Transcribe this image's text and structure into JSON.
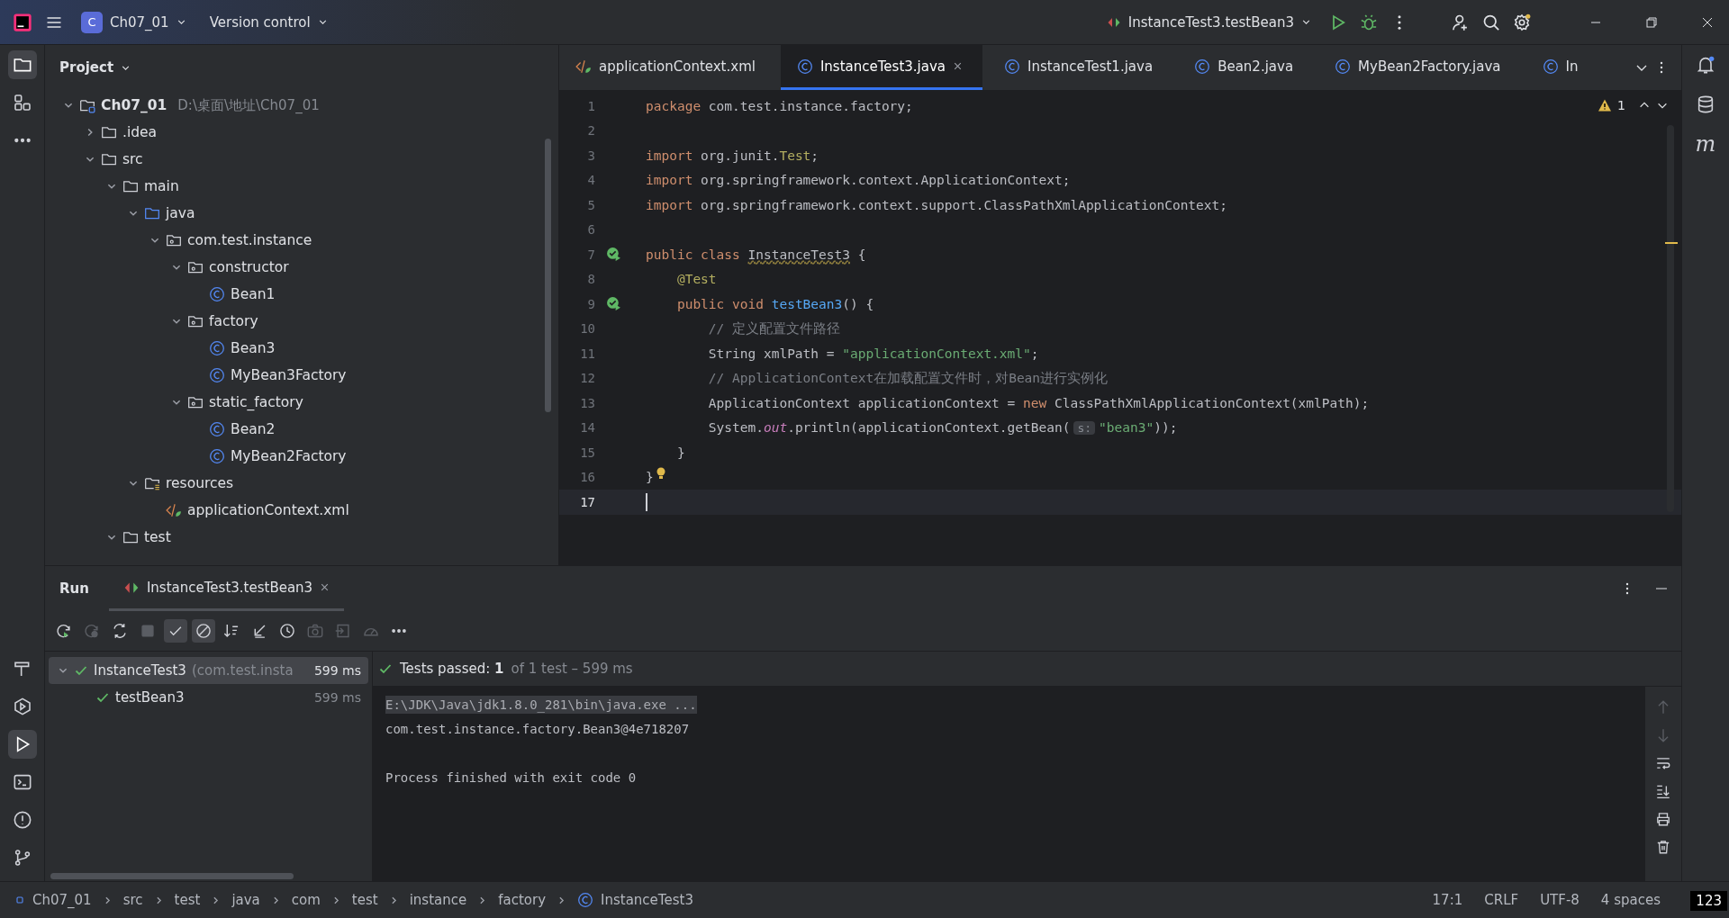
{
  "title_bar": {
    "project_badge": "C",
    "project": "Ch07_01",
    "vcs": "Version control",
    "run_config": "InstanceTest3.testBean3"
  },
  "left_stripe": {
    "top": [
      {
        "kind": "folder",
        "selected": true
      },
      {
        "kind": "structure",
        "selected": false
      },
      {
        "kind": "more",
        "selected": false
      }
    ],
    "bottom": [
      {
        "kind": "build",
        "selected": false
      },
      {
        "kind": "services",
        "selected": false
      },
      {
        "kind": "run",
        "selected": true
      },
      {
        "kind": "terminal",
        "selected": false
      },
      {
        "kind": "problems",
        "selected": false
      },
      {
        "kind": "git",
        "selected": false
      }
    ]
  },
  "project_panel": {
    "title": "Project",
    "tree": [
      {
        "kind": "module",
        "name": "Ch07_01",
        "path": "D:\\桌面\\地址\\Ch07_01",
        "expanded": true,
        "children": [
          {
            "kind": "folder",
            "name": ".idea",
            "expanded": false
          },
          {
            "kind": "folder",
            "name": "src",
            "expanded": true,
            "children": [
              {
                "kind": "folder",
                "name": "main",
                "expanded": true,
                "children": [
                  {
                    "kind": "source",
                    "name": "java",
                    "expanded": true,
                    "children": [
                      {
                        "kind": "package",
                        "name": "com.test.instance",
                        "expanded": true,
                        "children": [
                          {
                            "kind": "package",
                            "name": "constructor",
                            "expanded": true,
                            "children": [
                              {
                                "kind": "class",
                                "name": "Bean1"
                              }
                            ]
                          },
                          {
                            "kind": "package",
                            "name": "factory",
                            "expanded": true,
                            "children": [
                              {
                                "kind": "class",
                                "name": "Bean3"
                              },
                              {
                                "kind": "class",
                                "name": "MyBean3Factory"
                              }
                            ]
                          },
                          {
                            "kind": "package",
                            "name": "static_factory",
                            "expanded": true,
                            "children": [
                              {
                                "kind": "class",
                                "name": "Bean2"
                              },
                              {
                                "kind": "class",
                                "name": "MyBean2Factory"
                              }
                            ]
                          }
                        ]
                      }
                    ]
                  },
                  {
                    "kind": "resources",
                    "name": "resources",
                    "expanded": true,
                    "children": [
                      {
                        "kind": "xml",
                        "name": "applicationContext.xml"
                      }
                    ]
                  }
                ]
              },
              {
                "kind": "folder",
                "name": "test",
                "expanded": true
              }
            ]
          }
        ]
      }
    ]
  },
  "editor": {
    "tabs": [
      {
        "kind": "xml",
        "label": "applicationContext.xml",
        "selected": false
      },
      {
        "kind": "class",
        "label": "InstanceTest3.java",
        "selected": true
      },
      {
        "kind": "class",
        "label": "InstanceTest1.java",
        "selected": false
      },
      {
        "kind": "class",
        "label": "Bean2.java",
        "selected": false
      },
      {
        "kind": "class",
        "label": "MyBean2Factory.java",
        "selected": false
      },
      {
        "kind": "class",
        "label": "In",
        "selected": false
      }
    ],
    "warning_count": "1",
    "lines": [
      {
        "number": "1",
        "tokens": [
          {
            "kind": "kw",
            "text": "package"
          },
          {
            "kind": "plain",
            "text": " com.test.instance.factory;"
          }
        ]
      },
      {
        "number": "2"
      },
      {
        "number": "3",
        "tokens": [
          {
            "kind": "kw",
            "text": "import"
          },
          {
            "kind": "plain",
            "text": " org.junit."
          },
          {
            "kind": "ann",
            "text": "Test"
          },
          {
            "kind": "plain",
            "text": ";"
          }
        ]
      },
      {
        "number": "4",
        "tokens": [
          {
            "kind": "kw",
            "text": "import"
          },
          {
            "kind": "plain",
            "text": " org.springframework.context.ApplicationContext;"
          }
        ]
      },
      {
        "number": "5",
        "tokens": [
          {
            "kind": "kw",
            "text": "import"
          },
          {
            "kind": "plain",
            "text": " org.springframework.context.support.ClassPathXmlApplicationContext;"
          }
        ]
      },
      {
        "number": "6"
      },
      {
        "number": "7",
        "run_marker": true,
        "tokens": [
          {
            "kind": "kw",
            "text": "public class "
          },
          {
            "kind": "decl",
            "text": "InstanceTest3"
          },
          {
            "kind": "plain",
            "text": " {"
          }
        ]
      },
      {
        "number": "8",
        "tokens": [
          {
            "kind": "ann",
            "text": "    @Test"
          }
        ]
      },
      {
        "number": "9",
        "run_marker": true,
        "tokens": [
          {
            "kind": "kw",
            "text": "    public void "
          },
          {
            "kind": "fn",
            "text": "testBean3"
          },
          {
            "kind": "plain",
            "text": "() {"
          }
        ]
      },
      {
        "number": "10",
        "tokens": [
          {
            "kind": "comment",
            "text": "        // 定义配置文件路径"
          }
        ]
      },
      {
        "number": "11",
        "tokens": [
          {
            "kind": "plain",
            "text": "        String xmlPath = "
          },
          {
            "kind": "str",
            "text": "\"applicationContext.xml\""
          },
          {
            "kind": "plain",
            "text": ";"
          }
        ]
      },
      {
        "number": "12",
        "tokens": [
          {
            "kind": "comment",
            "text": "        // ApplicationContext在加载配置文件时，对Bean进行实例化"
          }
        ]
      },
      {
        "number": "13",
        "tokens": [
          {
            "kind": "plain",
            "text": "        ApplicationContext applicationContext = "
          },
          {
            "kind": "kw",
            "text": "new"
          },
          {
            "kind": "plain",
            "text": " ClassPathXmlApplicationContext(xmlPath);"
          }
        ]
      },
      {
        "number": "14",
        "tokens": [
          {
            "kind": "plain",
            "text": "        System."
          },
          {
            "kind": "static",
            "text": "out"
          },
          {
            "kind": "plain",
            "text": ".println(applicationContext.getBean("
          },
          {
            "kind": "hint",
            "text": "s:"
          },
          {
            "kind": "str",
            "text": "\"bean3\""
          },
          {
            "kind": "plain",
            "text": "));"
          }
        ]
      },
      {
        "number": "15",
        "tokens": [
          {
            "kind": "plain",
            "text": "    }"
          }
        ]
      },
      {
        "number": "16",
        "bulb": true,
        "tokens": [
          {
            "kind": "plain",
            "text": "}"
          }
        ]
      },
      {
        "number": "17",
        "current": true
      }
    ]
  },
  "right_stripe": [
    {
      "kind": "bell"
    },
    {
      "kind": "database"
    },
    {
      "kind": "maven",
      "label": "m"
    }
  ],
  "run_panel": {
    "title": "Run",
    "tab": "InstanceTest3.testBean3",
    "toolbar": [
      {
        "kind": "rerun",
        "on": false,
        "disabled": false
      },
      {
        "kind": "rerun-failed",
        "on": false,
        "disabled": true
      },
      {
        "kind": "toggle",
        "on": false,
        "disabled": false
      },
      {
        "kind": "stop",
        "on": false,
        "disabled": true
      },
      {
        "kind": "check",
        "on": true,
        "disabled": false
      },
      {
        "kind": "ignored",
        "on": true,
        "disabled": false
      },
      {
        "kind": "sort",
        "on": false,
        "disabled": false
      },
      {
        "kind": "collapse",
        "on": false,
        "disabled": false
      },
      {
        "kind": "history",
        "on": false,
        "disabled": false
      },
      {
        "kind": "camera",
        "on": false,
        "disabled": true
      },
      {
        "kind": "export",
        "on": false,
        "disabled": true
      },
      {
        "kind": "gauge",
        "on": false,
        "disabled": true
      },
      {
        "kind": "more",
        "on": false,
        "disabled": false
      }
    ],
    "tests": [
      {
        "name": "InstanceTest3",
        "detail": "(com.test.insta",
        "time": "599 ms",
        "selected": true,
        "expanded": true,
        "children": [
          {
            "name": "testBean3",
            "time": "599 ms",
            "selected": false
          }
        ]
      }
    ],
    "summary": "Tests passed: **1**",
    "summary_detail": "of 1 test – 599 ms",
    "console": [
      {
        "kind": "command",
        "text": "E:\\JDK\\Java\\jdk1.8.0_281\\bin\\java.exe ..."
      },
      {
        "kind": "output",
        "text": "com.test.instance.factory.Bean3@4e718207"
      },
      {
        "kind": "exit",
        "text": "Process finished with exit code 0"
      }
    ],
    "side_tools": [
      {
        "kind": "up",
        "disabled": true
      },
      {
        "kind": "down",
        "disabled": true
      },
      {
        "kind": "wrap",
        "disabled": false
      },
      {
        "kind": "scroll-end",
        "disabled": false
      },
      {
        "kind": "print",
        "disabled": false
      },
      {
        "kind": "trash",
        "disabled": false
      }
    ]
  },
  "status_bar": {
    "breadcrumbs": [
      {
        "kind": "module",
        "text": "Ch07_01"
      },
      {
        "kind": "dir",
        "text": "src"
      },
      {
        "kind": "dir",
        "text": "test"
      },
      {
        "kind": "dir",
        "text": "java"
      },
      {
        "kind": "dir",
        "text": "com"
      },
      {
        "kind": "dir",
        "text": "test"
      },
      {
        "kind": "dir",
        "text": "instance"
      },
      {
        "kind": "dir",
        "text": "factory"
      },
      {
        "kind": "class",
        "text": "InstanceTest3"
      }
    ],
    "position": "17:1",
    "line_separator": "CRLF",
    "encoding": "UTF-8",
    "indent": "4 spaces",
    "ime_indicator": "123"
  }
}
